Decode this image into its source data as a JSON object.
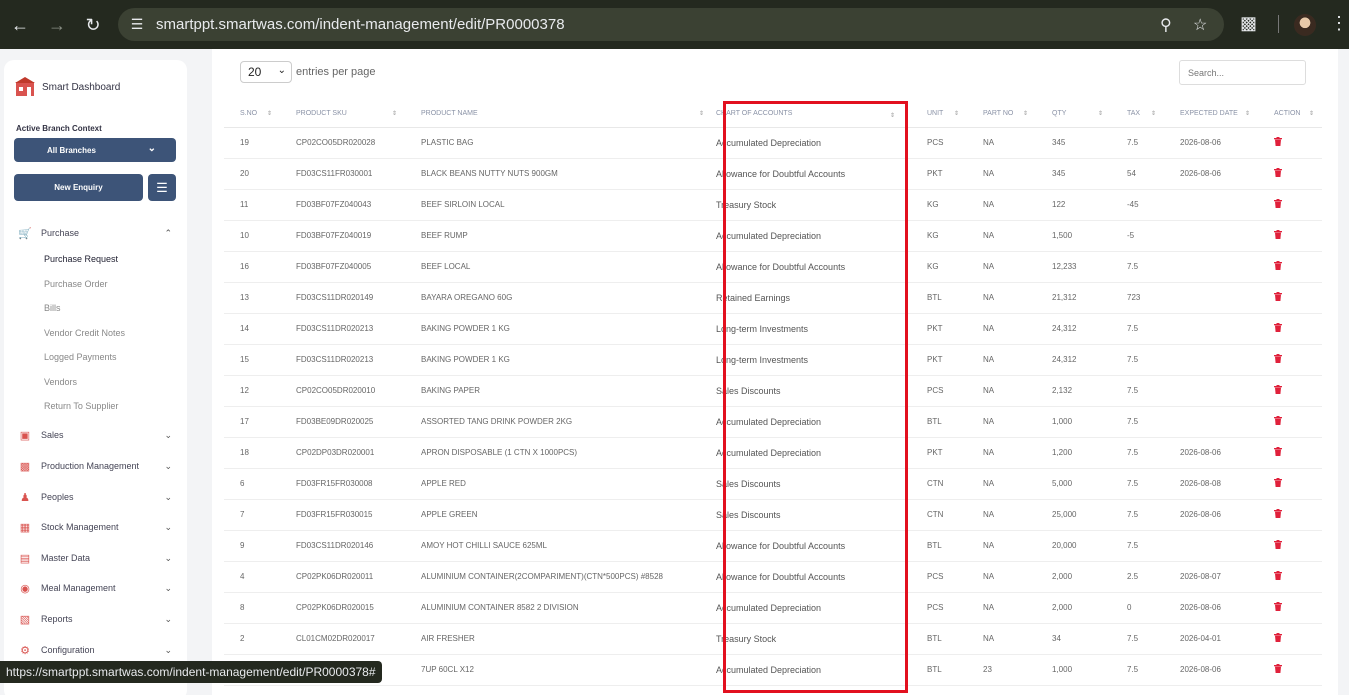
{
  "browser": {
    "url": "smartppt.smartwas.com/indent-management/edit/PR0000378",
    "status_url": "https://smartppt.smartwas.com/indent-management/edit/PR0000378#"
  },
  "sidebar": {
    "brand": "Smart Dashboard",
    "branch_label": "Active Branch Context",
    "branch_value": "All Branches",
    "new_enquiry": "New Enquiry",
    "purchase": {
      "label": "Purchase",
      "subitems": [
        "Purchase Request",
        "Purchase Order",
        "Bills",
        "Vendor Credit Notes",
        "Logged Payments",
        "Vendors",
        "Return To Supplier"
      ]
    },
    "items": [
      "Sales",
      "Production Management",
      "Peoples",
      "Stock Management",
      "Master Data",
      "Meal Management",
      "Reports",
      "Configuration"
    ]
  },
  "table_controls": {
    "page_size": "20",
    "entries_text": "entries per page",
    "search_placeholder": "Search..."
  },
  "columns": [
    "S.NO",
    "PRODUCT SKU",
    "PRODUCT NAME",
    "CHART OF ACCOUNTS",
    "UNIT",
    "PART NO",
    "QTY",
    "TAX",
    "EXPECTED DATE",
    "ACTION"
  ],
  "rows": [
    {
      "sno": "19",
      "sku": "CP02CO05DR020028",
      "name": "PLASTIC BAG",
      "coa": "Accumulated Depreciation",
      "unit": "PCS",
      "part": "NA",
      "qty": "345",
      "tax": "7.5",
      "date": "2026-08-06"
    },
    {
      "sno": "20",
      "sku": "FD03CS11FR030001",
      "name": "BLACK BEANS NUTTY NUTS 900GM",
      "coa": "Allowance for Doubtful Accounts",
      "unit": "PKT",
      "part": "NA",
      "qty": "345",
      "tax": "54",
      "date": "2026-08-06"
    },
    {
      "sno": "11",
      "sku": "FD03BF07FZ040043",
      "name": "BEEF SIRLOIN LOCAL",
      "coa": "Treasury Stock",
      "unit": "KG",
      "part": "NA",
      "qty": "122",
      "tax": "-45",
      "date": ""
    },
    {
      "sno": "10",
      "sku": "FD03BF07FZ040019",
      "name": "BEEF RUMP",
      "coa": "Accumulated Depreciation",
      "unit": "KG",
      "part": "NA",
      "qty": "1,500",
      "tax": "-5",
      "date": ""
    },
    {
      "sno": "16",
      "sku": "FD03BF07FZ040005",
      "name": "BEEF LOCAL",
      "coa": "Allowance for Doubtful Accounts",
      "unit": "KG",
      "part": "NA",
      "qty": "12,233",
      "tax": "7.5",
      "date": ""
    },
    {
      "sno": "13",
      "sku": "FD03CS11DR020149",
      "name": "BAYARA OREGANO 60G",
      "coa": "Retained Earnings",
      "unit": "BTL",
      "part": "NA",
      "qty": "21,312",
      "tax": "723",
      "date": ""
    },
    {
      "sno": "14",
      "sku": "FD03CS11DR020213",
      "name": "BAKING POWDER 1 KG",
      "coa": "Long-term Investments",
      "unit": "PKT",
      "part": "NA",
      "qty": "24,312",
      "tax": "7.5",
      "date": ""
    },
    {
      "sno": "15",
      "sku": "FD03CS11DR020213",
      "name": "BAKING POWDER 1 KG",
      "coa": "Long-term Investments",
      "unit": "PKT",
      "part": "NA",
      "qty": "24,312",
      "tax": "7.5",
      "date": ""
    },
    {
      "sno": "12",
      "sku": "CP02CO05DR020010",
      "name": "BAKING PAPER",
      "coa": "Sales Discounts",
      "unit": "PCS",
      "part": "NA",
      "qty": "2,132",
      "tax": "7.5",
      "date": ""
    },
    {
      "sno": "17",
      "sku": "FD03BE09DR020025",
      "name": "ASSORTED TANG DRINK POWDER 2KG",
      "coa": "Accumulated Depreciation",
      "unit": "BTL",
      "part": "NA",
      "qty": "1,000",
      "tax": "7.5",
      "date": ""
    },
    {
      "sno": "18",
      "sku": "CP02DP03DR020001",
      "name": "APRON DISPOSABLE (1 CTN X 1000PCS)",
      "coa": "Accumulated Depreciation",
      "unit": "PKT",
      "part": "NA",
      "qty": "1,200",
      "tax": "7.5",
      "date": "2026-08-06"
    },
    {
      "sno": "6",
      "sku": "FD03FR15FR030008",
      "name": "APPLE RED",
      "coa": "Sales Discounts",
      "unit": "CTN",
      "part": "NA",
      "qty": "5,000",
      "tax": "7.5",
      "date": "2026-08-08"
    },
    {
      "sno": "7",
      "sku": "FD03FR15FR030015",
      "name": "APPLE GREEN",
      "coa": "Sales Discounts",
      "unit": "CTN",
      "part": "NA",
      "qty": "25,000",
      "tax": "7.5",
      "date": "2026-08-06"
    },
    {
      "sno": "9",
      "sku": "FD03CS11DR020146",
      "name": "AMOY HOT CHILLI SAUCE 625ML",
      "coa": "Allowance for Doubtful Accounts",
      "unit": "BTL",
      "part": "NA",
      "qty": "20,000",
      "tax": "7.5",
      "date": ""
    },
    {
      "sno": "4",
      "sku": "CP02PK06DR020011",
      "name": "ALUMINIUM CONTAINER(2COMPARIMENT)(CTN*500PCS) #8528",
      "coa": "Allowance for Doubtful Accounts",
      "unit": "PCS",
      "part": "NA",
      "qty": "2,000",
      "tax": "2.5",
      "date": "2026-08-07"
    },
    {
      "sno": "8",
      "sku": "CP02PK06DR020015",
      "name": "ALUMINIUM CONTAINER 8582 2 DIVISION",
      "coa": "Accumulated Depreciation",
      "unit": "PCS",
      "part": "NA",
      "qty": "2,000",
      "tax": "0",
      "date": "2026-08-06"
    },
    {
      "sno": "2",
      "sku": "CL01CM02DR020017",
      "name": "AIR FRESHER",
      "coa": "Treasury Stock",
      "unit": "BTL",
      "part": "NA",
      "qty": "34",
      "tax": "7.5",
      "date": "2026-04-01"
    },
    {
      "sno": "",
      "sku": "",
      "name": "7UP 60CL X12",
      "coa": "Accumulated Depreciation",
      "unit": "BTL",
      "part": "23",
      "qty": "1,000",
      "tax": "7.5",
      "date": "2026-08-06"
    }
  ]
}
